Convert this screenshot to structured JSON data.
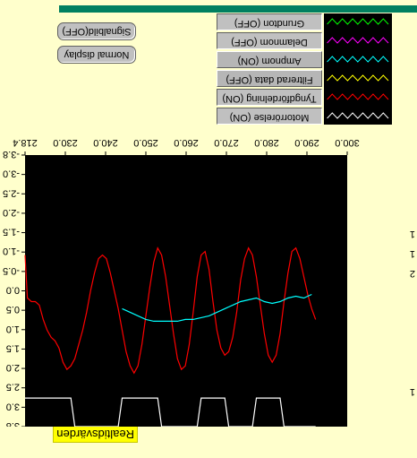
{
  "chart_title": "Realtidsvärden",
  "side_buttons": [
    "Signalbild(OFF)",
    "Normal display"
  ],
  "legend_buttons": [
    {
      "label": "Grundton (OFF)",
      "pressed": false,
      "color": "#00ff00"
    },
    {
      "label": "Delamnom (OFF)",
      "pressed": false,
      "color": "#ff00ff"
    },
    {
      "label": "Ampnom (ON)",
      "pressed": true,
      "color": "#00ffff"
    },
    {
      "label": "Filtrerad data (OFF)",
      "pressed": false,
      "color": "#ffff00"
    },
    {
      "label": "Tyngdfördelning (ON)",
      "pressed": true,
      "color": "#ff0000"
    },
    {
      "label": "Motorrörelse (ON)",
      "pressed": true,
      "color": "#ffffff"
    }
  ],
  "right_margin_labels": [
    "1",
    "1",
    "2",
    "1"
  ],
  "colors": {
    "background": "#ffffcc",
    "plot": "#000000",
    "topbar": "#008060",
    "title_chip": "#ffff00"
  },
  "chart_data": {
    "type": "line",
    "x_ticks": [
      "218.4",
      "230.0",
      "240.0",
      "250.0",
      "260.0",
      "270.0",
      "280.0",
      "290.0",
      "300.0"
    ],
    "xlim": [
      218.4,
      300.0
    ],
    "y_ticks": [
      "3.8",
      "3.0",
      "2.5",
      "2.0",
      "1.5",
      "1.0",
      "0.5",
      "0.0",
      "-0.5",
      "-1.0",
      "-1.5",
      "-2.0",
      "-2.5",
      "-3.0",
      "-3.8"
    ],
    "ylim": [
      -3.8,
      3.8
    ],
    "series": [
      {
        "color": "#ff0000",
        "x": [
          218.4,
          219.0,
          220.0,
          221.0,
          222.0,
          223.0,
          224.0,
          225.0,
          226.0,
          227.0,
          228.0,
          229.0,
          230.0,
          231.0,
          232.0,
          233.0,
          234.0,
          235.0,
          236.0,
          237.0,
          238.0,
          239.0,
          240.0,
          241.0,
          242.0,
          243.0,
          244.0,
          245.0,
          246.0,
          247.0,
          248.0,
          249.0,
          250.0,
          251.0,
          252.0,
          253.0,
          254.0,
          255.0,
          256.0,
          257.0,
          258.0,
          259.0,
          260.0,
          261.0,
          262.0,
          263.0,
          264.0,
          265.0,
          266.0,
          267.0,
          268.0,
          269.0,
          270.0,
          271.0,
          272.0,
          273.0,
          274.0,
          275.0,
          276.0,
          277.0,
          278.0,
          279.0,
          280.0,
          281.0,
          282.0,
          283.0,
          284.0,
          285.0,
          286.0,
          287.0,
          288.0,
          289.0,
          290.0,
          291.0,
          292.0
        ],
        "y": [
          -1.0,
          0.2,
          0.3,
          0.3,
          0.4,
          0.8,
          1.1,
          1.3,
          1.4,
          1.6,
          2.0,
          2.2,
          2.1,
          1.9,
          1.5,
          1.1,
          0.6,
          0.0,
          -0.5,
          -0.9,
          -1.0,
          -0.9,
          -0.5,
          0.0,
          0.5,
          1.1,
          1.7,
          2.1,
          2.3,
          2.1,
          1.5,
          0.7,
          -0.1,
          -0.8,
          -1.2,
          -1.0,
          -0.4,
          0.4,
          1.2,
          1.9,
          2.2,
          2.1,
          1.5,
          0.6,
          -0.4,
          -1.0,
          -1.1,
          -0.6,
          0.3,
          1.1,
          1.6,
          1.8,
          1.7,
          1.3,
          0.6,
          -0.3,
          -0.9,
          -1.2,
          -1.0,
          -0.4,
          0.4,
          1.2,
          1.8,
          2.0,
          1.8,
          1.2,
          0.3,
          -0.5,
          -1.1,
          -1.2,
          -0.9,
          -0.4,
          0.1,
          0.5,
          0.8
        ]
      },
      {
        "color": "#00ffff",
        "x": [
          243.0,
          245.0,
          247.0,
          249.0,
          251.0,
          253.0,
          255.0,
          257.0,
          259.0,
          261.0,
          263.0,
          265.0,
          267.0,
          269.0,
          271.0,
          273.0,
          275.0,
          277.0,
          279.0,
          281.0,
          283.0,
          285.0,
          287.0,
          289.0,
          291.0
        ],
        "y": [
          0.5,
          0.6,
          0.7,
          0.8,
          0.85,
          0.85,
          0.85,
          0.85,
          0.8,
          0.8,
          0.75,
          0.7,
          0.6,
          0.5,
          0.4,
          0.3,
          0.25,
          0.2,
          0.3,
          0.35,
          0.3,
          0.2,
          0.15,
          0.2,
          0.1
        ]
      },
      {
        "color": "#ffffff",
        "x": [
          218.4,
          219.0,
          225.0,
          230.0,
          231.0,
          240.0,
          242.0,
          243.0,
          252.0,
          253.0,
          262.0,
          263.0,
          269.0,
          270.0,
          276.0,
          277.0,
          283.0,
          284.0,
          290.0,
          292.0
        ],
        "y": [
          3.0,
          3.0,
          3.0,
          3.0,
          3.8,
          3.8,
          3.8,
          3.0,
          3.0,
          3.8,
          3.8,
          3.0,
          3.0,
          3.8,
          3.8,
          3.0,
          3.0,
          3.8,
          3.8,
          3.8
        ]
      }
    ]
  }
}
